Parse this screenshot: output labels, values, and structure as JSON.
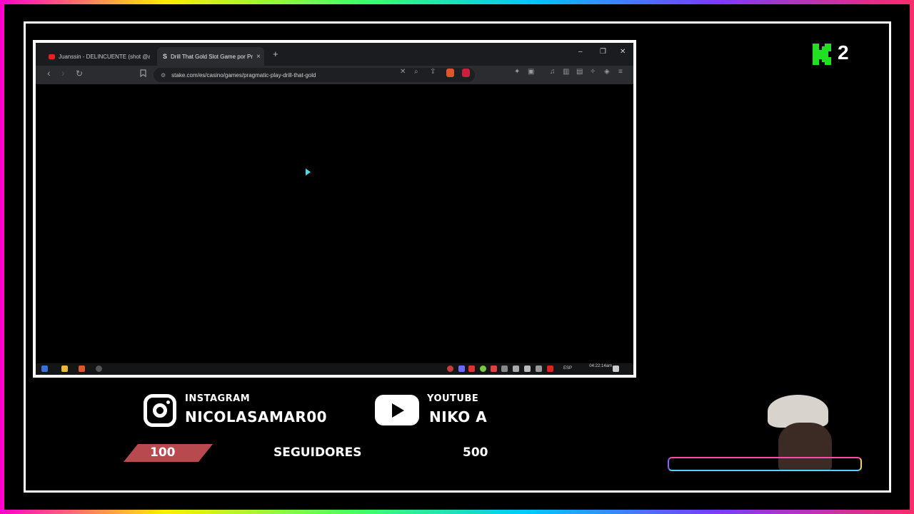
{
  "browser": {
    "tabs": [
      {
        "label": "Juanssin - DELINCUENTE (shot @arte",
        "favicon_color": "#e02424",
        "active": false
      },
      {
        "label": "Drill That Gold Slot Game por Pr",
        "favicon_color": "#cfcfcf",
        "active": true
      }
    ],
    "new_tab_icon": "plus-icon",
    "window_controls": {
      "minimize": "–",
      "restore": "❐",
      "close": "✕"
    },
    "toolbar": {
      "back": "‹",
      "forward": "›",
      "reload": "↻",
      "url": "stake.com/es/casino/games/pragmatic-play-drill-that-gold"
    },
    "taskbar": {
      "lang": "ESP",
      "time": "04:22:14am"
    }
  },
  "overlay": {
    "logo_number": "2",
    "logo_color": "#1fe021",
    "instagram": {
      "label": "INSTAGRAM",
      "handle": "NICOLASAMAR00"
    },
    "youtube": {
      "label": "YOUTUBE",
      "handle": "NIKO A"
    },
    "followers": {
      "current": "100",
      "label": "SEGUIDORES",
      "goal": "500",
      "bar_color": "#b8494f"
    }
  }
}
